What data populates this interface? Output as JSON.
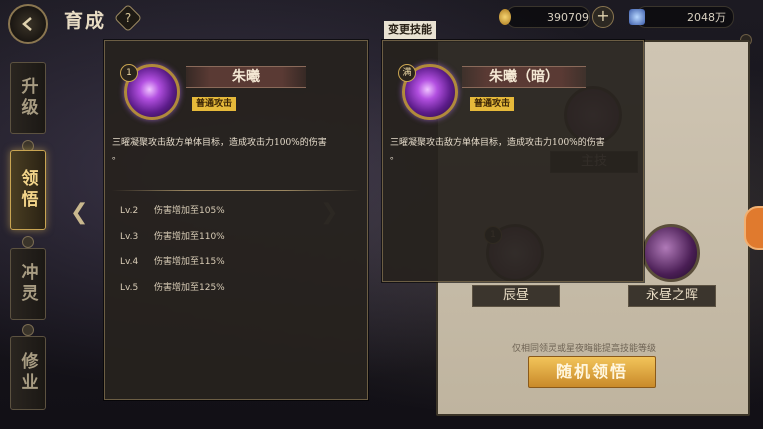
{
  "header": {
    "title": "育成",
    "help_label": "?",
    "coins": "390709",
    "plus_label": "+",
    "crystals": "2048万"
  },
  "side_tabs": [
    {
      "label": "升级"
    },
    {
      "label": "领悟"
    },
    {
      "label": "冲灵"
    },
    {
      "label": "修业"
    }
  ],
  "left_card": {
    "level_badge": "1",
    "skill_name": "朱曦",
    "skill_type": "普通攻击",
    "description": "三曜凝聚攻击敌方单体目标，造成攻击力100%的伤害",
    "end_mark": "。",
    "upgrades": [
      {
        "level": "Lv.2",
        "effect": "伤害增加至105%"
      },
      {
        "level": "Lv.3",
        "effect": "伤害增加至110%"
      },
      {
        "level": "Lv.4",
        "effect": "伤害增加至115%"
      },
      {
        "level": "Lv.5",
        "effect": "伤害增加至125%"
      }
    ]
  },
  "right_card": {
    "header": "变更技能",
    "level_badge": "满",
    "skill_name": "朱曦（暗）",
    "skill_type": "普通攻击",
    "description": "三曜凝聚攻击敌方单体目标，造成攻击力100%的伤害",
    "end_mark": "。"
  },
  "background_panel": {
    "top_slot_label": "主技",
    "slots": [
      {
        "label": "辰昼",
        "badge": "1"
      },
      {
        "label": "永昼之晖",
        "badge": ""
      }
    ],
    "hint": "仅相同领灵或星夜晦能提高技能等级",
    "random_button": "随机领悟"
  },
  "colors": {
    "accent_gold": "#e6b93a",
    "active_tab": "#f3d58a"
  }
}
